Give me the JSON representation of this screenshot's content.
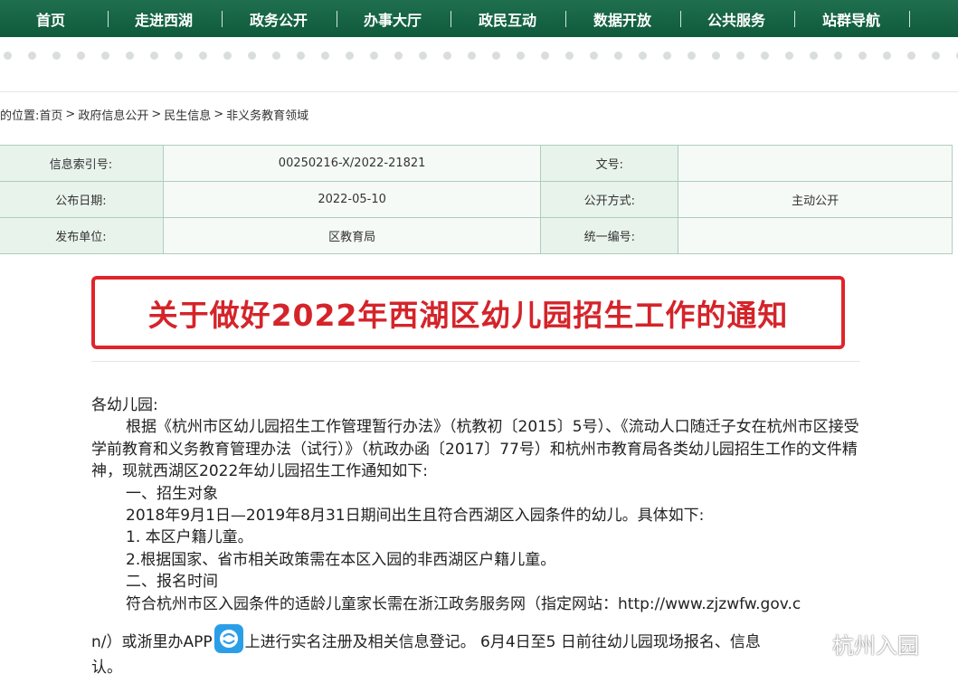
{
  "nav": {
    "items": [
      "首页",
      "走进西湖",
      "政务公开",
      "办事大厅",
      "政民互动",
      "数据开放",
      "公共服务",
      "站群导航"
    ]
  },
  "breadcrumb": {
    "prefix": "的位置:",
    "items": [
      "首页",
      "政府信息公开",
      "民生信息",
      "非义务教育领域"
    ],
    "separator": ">"
  },
  "meta": {
    "index_label": "信息索引号:",
    "index_value": "00250216-X/2022-21821",
    "doc_no_label": "文号:",
    "doc_no_value": "",
    "date_label": "公布日期:",
    "date_value": "2022-05-10",
    "method_label": "公开方式:",
    "method_value": "主动公开",
    "unit_label": "发布单位:",
    "unit_value": "区教育局",
    "serial_label": "统一编号:",
    "serial_value": ""
  },
  "article": {
    "title": "关于做好2022年西湖区幼儿园招生工作的通知",
    "salutation": "各幼儿园:",
    "para1": "根据《杭州市区幼儿园招生工作管理暂行办法》（杭教初〔2015〕5号）、《流动人口随迁子女在杭州市区接受学前教育和义务教育管理办法（试行）》（杭政办函〔2017〕77号）和杭州市教育局各类幼儿园招生工作的文件精神，现就西湖区2022年幼儿园招生工作通知如下:",
    "section1": "一、招生对象",
    "section1_text": "2018年9月1日—2019年8月31日期间出生且符合西湖区入园条件的幼儿。具体如下:",
    "item1": "1. 本区户籍儿童。",
    "item2": "2.根据国家、省市相关政策需在本区入园的非西湖区户籍儿童。",
    "section2": "二、报名时间",
    "section2_text": "符合杭州市区入园条件的适龄儿童家长需在浙江政务服务网（指定网站：http://www.zjzwfw.gov.c",
    "tail_before_icon": "n/）或浙里办APP",
    "tail_after_icon": "上进行实名注册及相关信息登记。 6月4日至5 日前往幼儿园现场报名、信息",
    "tail_last": "认。"
  },
  "watermark": {
    "text": "杭州入园",
    "icon": "wechat-icon"
  },
  "colors": {
    "nav_bg": "#0f5a3c",
    "title_red": "#d4242a",
    "table_border": "#aecdbb",
    "table_label_bg": "#e8f3ec"
  }
}
